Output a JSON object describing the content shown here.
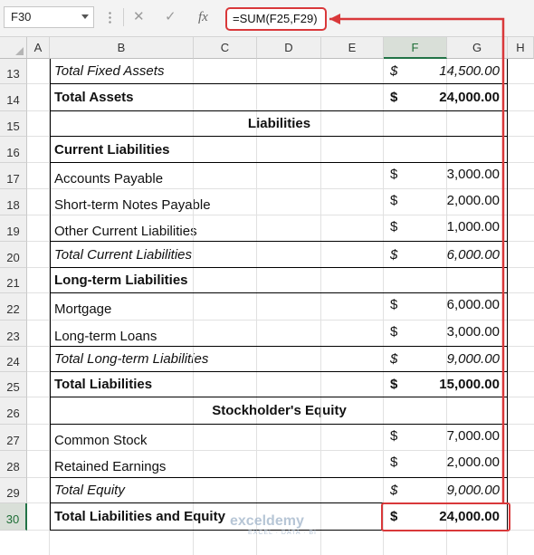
{
  "formula_bar": {
    "name_box": "F30",
    "cancel_icon": "✕",
    "enter_icon": "✓",
    "fx_icon": "fx",
    "formula": "=SUM(F25,F29)"
  },
  "columns": [
    "A",
    "B",
    "C",
    "D",
    "E",
    "F",
    "G",
    "H"
  ],
  "rows": [
    {
      "num": "13",
      "label": "Total Fixed Assets",
      "style": "italic",
      "sym": "$",
      "value": "14,500.00"
    },
    {
      "num": "14",
      "label": "Total Assets",
      "style": "bold",
      "sym": "$",
      "value": "24,000.00"
    },
    {
      "num": "15",
      "label": "Liabilities",
      "style": "header",
      "sym": "",
      "value": ""
    },
    {
      "num": "16",
      "label": "Current Liabilities",
      "style": "bold",
      "sym": "",
      "value": ""
    },
    {
      "num": "17",
      "label": "Accounts Payable",
      "style": "normal",
      "sym": "$",
      "value": "3,000.00"
    },
    {
      "num": "18",
      "label": "Short-term Notes Payable",
      "style": "normal",
      "sym": "$",
      "value": "2,000.00"
    },
    {
      "num": "19",
      "label": "Other Current Liabilities",
      "style": "normal",
      "sym": "$",
      "value": "1,000.00"
    },
    {
      "num": "20",
      "label": "Total Current Liabilities",
      "style": "italic",
      "sym": "$",
      "value": "6,000.00"
    },
    {
      "num": "21",
      "label": "Long-term Liabilities",
      "style": "bold",
      "sym": "",
      "value": ""
    },
    {
      "num": "22",
      "label": "Mortgage",
      "style": "normal",
      "sym": "$",
      "value": "6,000.00"
    },
    {
      "num": "23",
      "label": "Long-term Loans",
      "style": "normal",
      "sym": "$",
      "value": "3,000.00"
    },
    {
      "num": "24",
      "label": "Total Long-term Liabilities",
      "style": "italic",
      "sym": "$",
      "value": "9,000.00"
    },
    {
      "num": "25",
      "label": "Total Liabilities",
      "style": "bold",
      "sym": "$",
      "value": "15,000.00"
    },
    {
      "num": "26",
      "label": "Stockholder's Equity",
      "style": "header",
      "sym": "",
      "value": ""
    },
    {
      "num": "27",
      "label": "Common Stock",
      "style": "normal",
      "sym": "$",
      "value": "7,000.00"
    },
    {
      "num": "28",
      "label": "Retained Earnings",
      "style": "normal",
      "sym": "$",
      "value": "2,000.00"
    },
    {
      "num": "29",
      "label": "Total Equity",
      "style": "italic",
      "sym": "$",
      "value": "9,000.00"
    },
    {
      "num": "30",
      "label": "Total Liabilities and Equity",
      "style": "bold",
      "sym": "$",
      "value": "24,000.00"
    }
  ],
  "selected_cell": {
    "column": "F",
    "row": "30"
  },
  "watermark": {
    "brand": "exceldemy",
    "tagline": "EXCEL · DATA · BI"
  },
  "colors": {
    "highlight": "#d9383a",
    "selection": "#217346"
  }
}
